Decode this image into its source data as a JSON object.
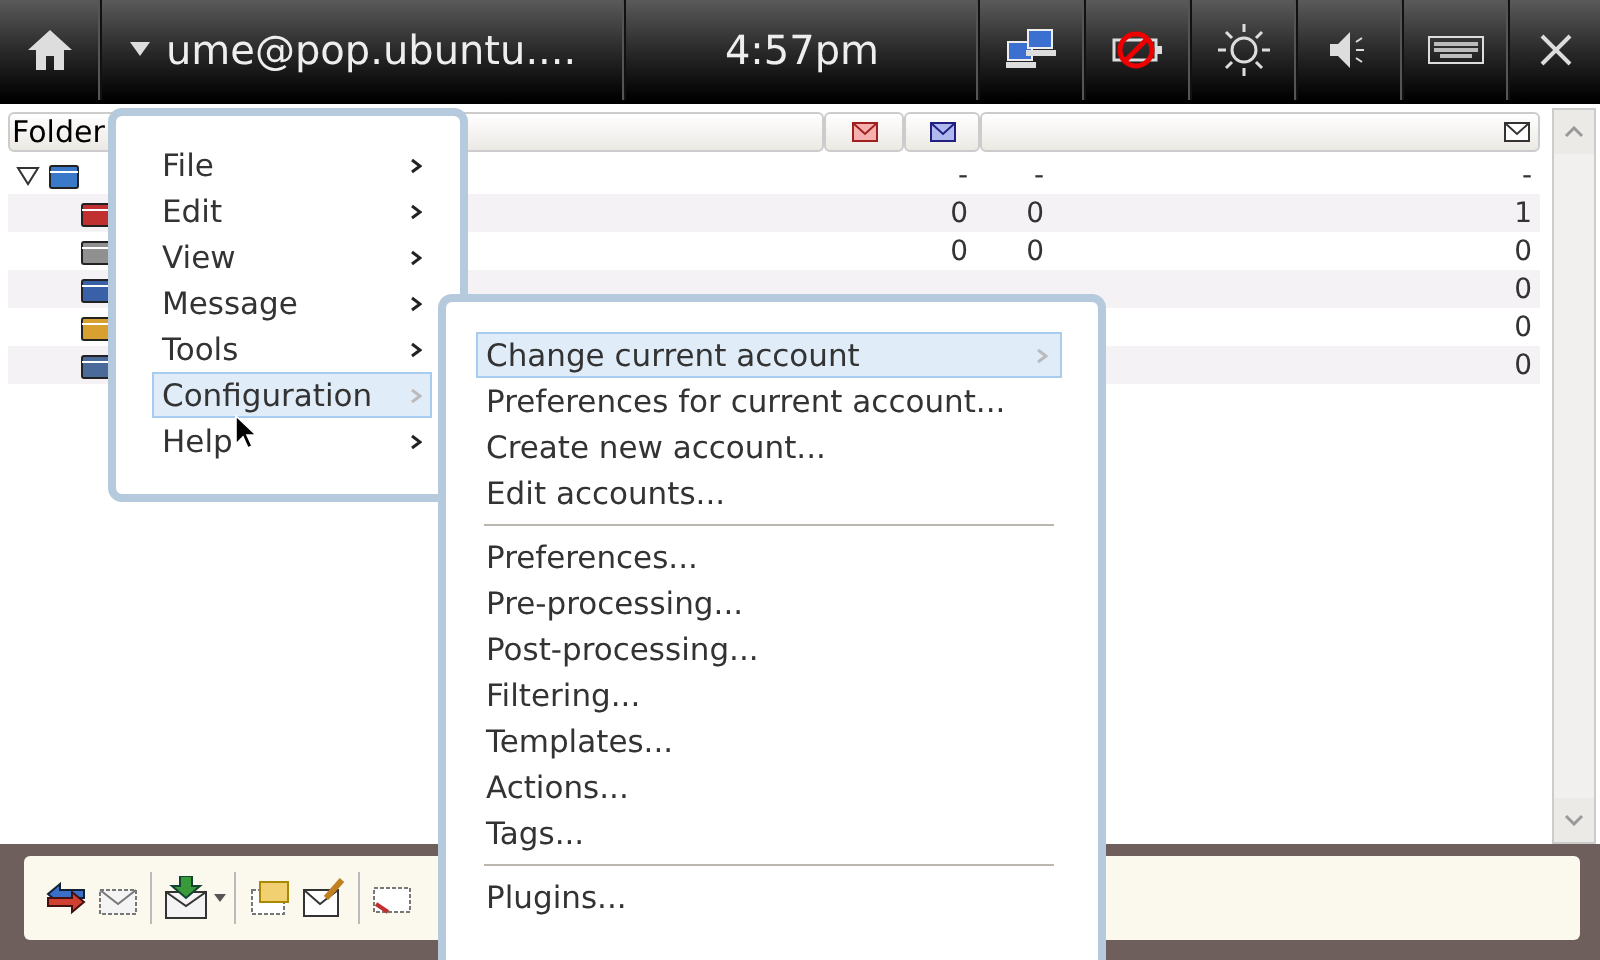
{
  "top_bar": {
    "account": "ume@pop.ubuntu....",
    "time": "4:57pm"
  },
  "folder_table": {
    "columns": [
      "Folder"
    ],
    "rows": [
      {
        "kind": "mailbox",
        "expanded": true,
        "new": "-",
        "unread": "-",
        "total": "-"
      },
      {
        "kind": "inbox",
        "new": "0",
        "unread": "0",
        "total": "1"
      },
      {
        "kind": "outbox",
        "new": "0",
        "unread": "0",
        "total": "0"
      },
      {
        "kind": "drafts",
        "total": "0"
      },
      {
        "kind": "queue",
        "total": "0"
      },
      {
        "kind": "trash",
        "total": "0"
      }
    ]
  },
  "menu": {
    "items": [
      {
        "label": "File",
        "selected": false
      },
      {
        "label": "Edit",
        "selected": false
      },
      {
        "label": "View",
        "selected": false
      },
      {
        "label": "Message",
        "selected": false
      },
      {
        "label": "Tools",
        "selected": false
      },
      {
        "label": "Configuration",
        "selected": true
      },
      {
        "label": "Help",
        "selected": false
      }
    ]
  },
  "submenu": {
    "items": [
      {
        "kind": "item",
        "label": "Change current account",
        "submenu": true,
        "selected": true
      },
      {
        "kind": "item",
        "label": "Preferences for current account...",
        "submenu": false,
        "selected": false
      },
      {
        "kind": "item",
        "label": "Create new account...",
        "submenu": false,
        "selected": false
      },
      {
        "kind": "item",
        "label": "Edit accounts...",
        "submenu": false,
        "selected": false
      },
      {
        "kind": "separator"
      },
      {
        "kind": "item",
        "label": "Preferences...",
        "submenu": false,
        "selected": false
      },
      {
        "kind": "item",
        "label": "Pre-processing...",
        "submenu": false,
        "selected": false
      },
      {
        "kind": "item",
        "label": "Post-processing...",
        "submenu": false,
        "selected": false
      },
      {
        "kind": "item",
        "label": "Filtering...",
        "submenu": false,
        "selected": false
      },
      {
        "kind": "item",
        "label": "Templates...",
        "submenu": false,
        "selected": false
      },
      {
        "kind": "item",
        "label": "Actions...",
        "submenu": false,
        "selected": false
      },
      {
        "kind": "item",
        "label": "Tags...",
        "submenu": false,
        "selected": false
      },
      {
        "kind": "separator"
      },
      {
        "kind": "item",
        "label": "Plugins...",
        "submenu": false,
        "selected": false
      }
    ]
  }
}
